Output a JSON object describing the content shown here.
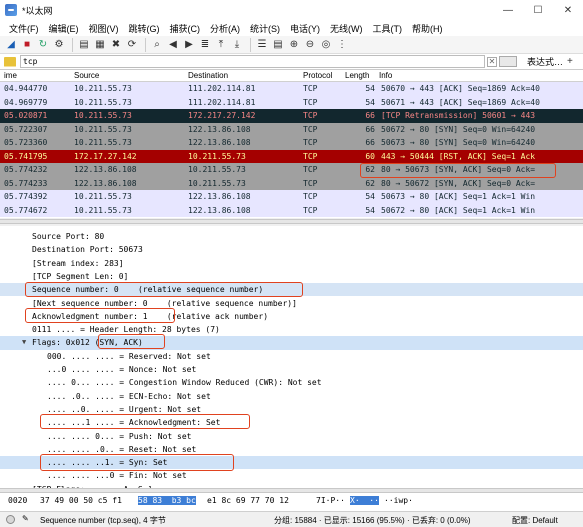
{
  "window": {
    "title": "*以太网",
    "minimize": "—",
    "maximize": "☐",
    "close": "✕"
  },
  "menu": [
    "文件(F)",
    "编辑(E)",
    "视图(V)",
    "跳转(G)",
    "捕获(C)",
    "分析(A)",
    "统计(S)",
    "电话(Y)",
    "无线(W)",
    "工具(T)",
    "帮助(H)"
  ],
  "filter": {
    "value": "tcp",
    "expression_label": "表达式…",
    "plus": "+"
  },
  "columns": {
    "time": "ime",
    "source": "Source",
    "destination": "Destination",
    "protocol": "Protocol",
    "length": "Length",
    "info": "Info"
  },
  "packets": [
    {
      "time": "04.944770",
      "src": "10.211.55.73",
      "dst": "111.202.114.81",
      "proto": "TCP",
      "len": "54",
      "info": "50670 → 443 [ACK] Seq=1869 Ack=40",
      "bg": "#e7e6ff",
      "fg": "#12272e"
    },
    {
      "time": "04.969779",
      "src": "10.211.55.73",
      "dst": "111.202.114.81",
      "proto": "TCP",
      "len": "54",
      "info": "50671 → 443 [ACK] Seq=1869 Ack=40",
      "bg": "#e7e6ff",
      "fg": "#12272e"
    },
    {
      "time": "05.020871",
      "src": "10.211.55.73",
      "dst": "172.217.27.142",
      "proto": "TCP",
      "len": "66",
      "info": "[TCP Retransmission] 50601 → 443",
      "bg": "#12272e",
      "fg": "#f78787"
    },
    {
      "time": "05.722307",
      "src": "10.211.55.73",
      "dst": "122.13.86.108",
      "proto": "TCP",
      "len": "66",
      "info": "50672 → 80 [SYN] Seq=0 Win=64240",
      "bg": "#a0a0a0",
      "fg": "#12272e"
    },
    {
      "time": "05.723360",
      "src": "10.211.55.73",
      "dst": "122.13.86.108",
      "proto": "TCP",
      "len": "66",
      "info": "50673 → 80 [SYN] Seq=0 Win=64240",
      "bg": "#a0a0a0",
      "fg": "#12272e"
    },
    {
      "time": "05.741795",
      "src": "172.17.27.142",
      "dst": "10.211.55.73",
      "proto": "TCP",
      "len": "60",
      "info": "443 → 50444 [RST, ACK] Seq=1 Ack",
      "bg": "#a40000",
      "fg": "#fffc9c"
    },
    {
      "time": "05.774232",
      "src": "122.13.86.108",
      "dst": "10.211.55.73",
      "proto": "TCP",
      "len": "62",
      "info": "80 → 50673 [SYN, ACK] Seq=0 Ack=",
      "bg": "#a0a0a0",
      "fg": "#12272e"
    },
    {
      "time": "05.774233",
      "src": "122.13.86.108",
      "dst": "10.211.55.73",
      "proto": "TCP",
      "len": "62",
      "info": "80 → 50672 [SYN, ACK] Seq=0 Ack=",
      "bg": "#a0a0a0",
      "fg": "#12272e"
    },
    {
      "time": "05.774392",
      "src": "10.211.55.73",
      "dst": "122.13.86.108",
      "proto": "TCP",
      "len": "54",
      "info": "50673 → 80 [ACK] Seq=1 Ack=1 Win",
      "bg": "#e7e6ff",
      "fg": "#12272e"
    },
    {
      "time": "05.774672",
      "src": "10.211.55.73",
      "dst": "122.13.86.108",
      "proto": "TCP",
      "len": "54",
      "info": "50672 → 80 [ACK] Seq=1 Ack=1 Win",
      "bg": "#e7e6ff",
      "fg": "#12272e"
    }
  ],
  "details": [
    "Source Port: 80",
    "Destination Port: 50673",
    "[Stream index: 283]",
    "[TCP Segment Len: 0]",
    "Sequence number: 0    (relative sequence number)",
    "[Next sequence number: 0    (relative sequence number)]",
    "Acknowledgment number: 1    (relative ack number)",
    "0111 .... = Header Length: 28 bytes (7)",
    "Flags: 0x012 (SYN, ACK)",
    "000. .... .... = Reserved: Not set",
    "...0 .... .... = Nonce: Not set",
    ".... 0... .... = Congestion Window Reduced (CWR): Not set",
    ".... .0.. .... = ECN-Echo: Not set",
    ".... ..0. .... = Urgent: Not set",
    ".... ...1 .... = Acknowledgment: Set",
    ".... .... 0... = Push: Not set",
    ".... .... .0.. = Reset: Not set",
    ".... .... ..1. = Syn: Set",
    ".... .... ...0 = Fin: Not set",
    "[TCP Flags: ·······A··S·]"
  ],
  "bytes": {
    "offset": "0020",
    "pre": "37 49 00 50 c5 f1",
    "sel": "58 83  b3 bc",
    "post": "e1 8c 69 77 70 12",
    "ascii_pre": "7I·P··",
    "ascii_sel": "X·  ··",
    "ascii_post": "··iwp·"
  },
  "status": {
    "field": "Sequence number (tcp.seq), 4 字节",
    "packets": "分组: 15884 · 已显示: 15166 (95.5%) · 已丢弃: 0 (0.0%)",
    "profile": "配置: Default"
  }
}
